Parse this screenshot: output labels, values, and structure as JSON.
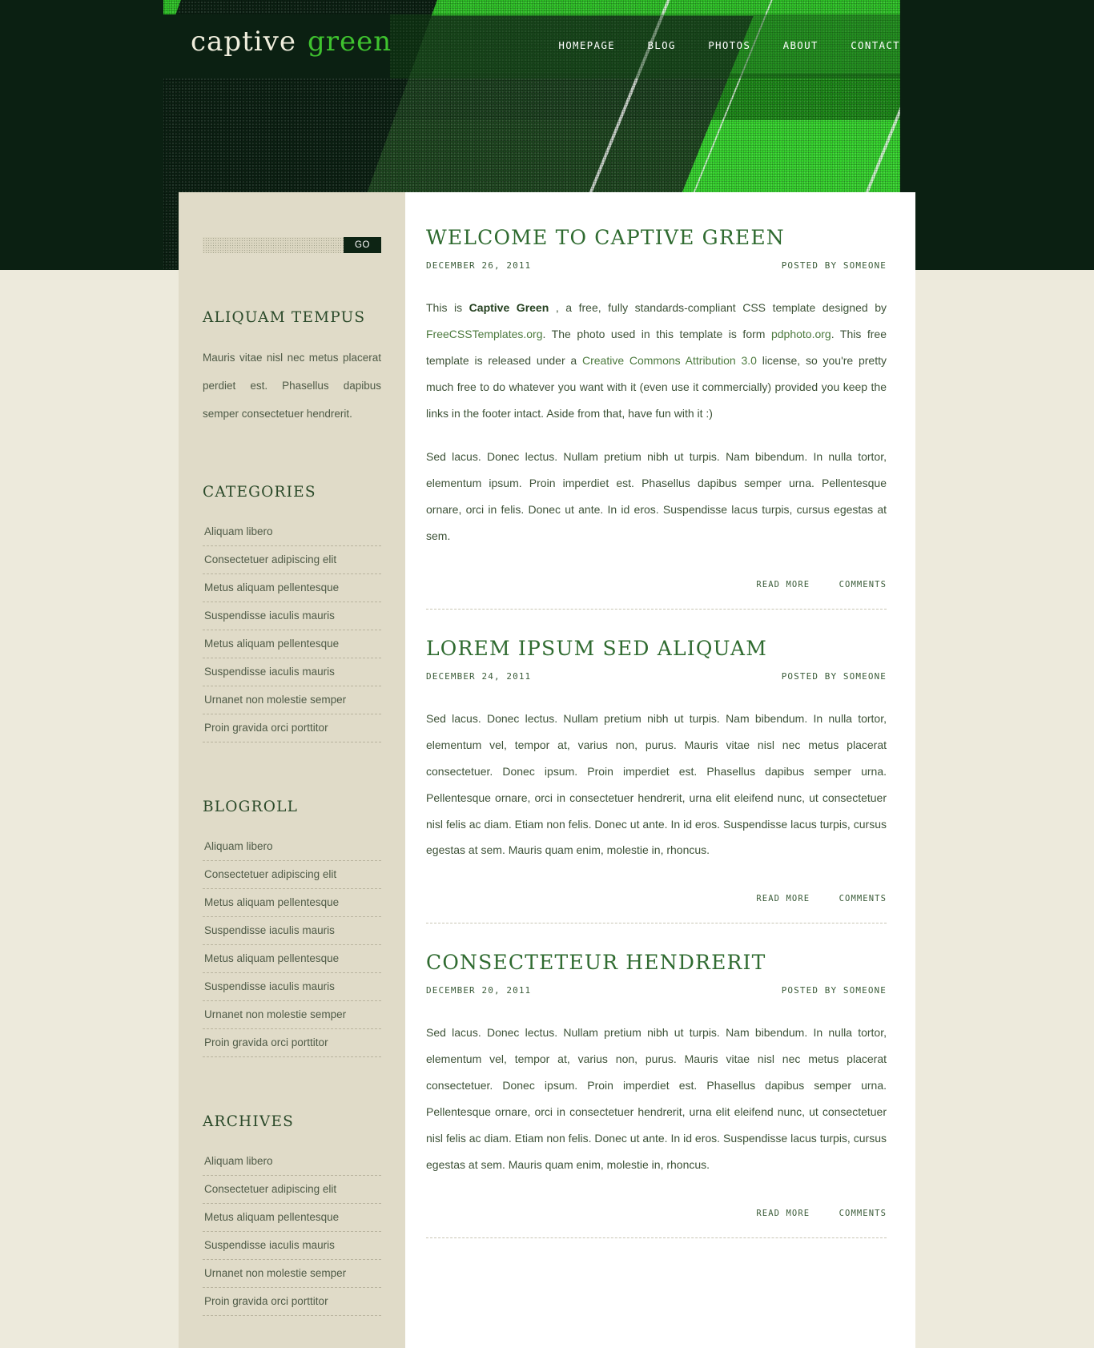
{
  "site": {
    "logo_word1": "captive",
    "logo_word2": "green",
    "accent_green": "#3FC32F",
    "dark_green": "#0B2012",
    "cream": "#EDEADC",
    "sidebar_bg": "#E0DBC8"
  },
  "nav": {
    "items": [
      {
        "label": "Homepage"
      },
      {
        "label": "Blog"
      },
      {
        "label": "Photos"
      },
      {
        "label": "About"
      },
      {
        "label": "Contact"
      }
    ]
  },
  "sidebar": {
    "search": {
      "value": "",
      "placeholder": "",
      "button_label": "GO"
    },
    "blurb": {
      "heading": "Aliquam Tempus",
      "text": "Mauris vitae nisl nec metus placerat perdiet est. Phasellus dapibus semper consectetuer hendrerit."
    },
    "sections": [
      {
        "heading": "Categories",
        "items": [
          "Aliquam libero",
          "Consectetuer adipiscing elit",
          "Metus aliquam pellentesque",
          "Suspendisse iaculis mauris",
          "Metus aliquam pellentesque",
          "Suspendisse iaculis mauris",
          "Urnanet non molestie semper",
          "Proin gravida orci porttitor"
        ]
      },
      {
        "heading": "Blogroll",
        "items": [
          "Aliquam libero",
          "Consectetuer adipiscing elit",
          "Metus aliquam pellentesque",
          "Suspendisse iaculis mauris",
          "Metus aliquam pellentesque",
          "Suspendisse iaculis mauris",
          "Urnanet non molestie semper",
          "Proin gravida orci porttitor"
        ]
      },
      {
        "heading": "Archives",
        "items": [
          "Aliquam libero",
          "Consectetuer adipiscing elit",
          "Metus aliquam pellentesque",
          "Suspendisse iaculis mauris",
          "Urnanet non molestie semper",
          "Proin gravida orci porttitor"
        ]
      }
    ]
  },
  "posts": [
    {
      "title": "Welcome to Captive Green",
      "date": "December 26, 2011",
      "author": "Posted by someone",
      "paragraphs": [
        "This is <b>Captive Green</b> , a free, fully standards-compliant CSS template designed by <a href=\"#\">FreeCSSTemplates.org</a>. The photo used in this template is form <a href=\"#\">pdphoto.org</a>. This free template is released under a <a href=\"#\">Creative Commons Attribution 3.0</a> license, so you're pretty much free to do whatever you want with it (even use it commercially) provided you keep the links in the footer intact. Aside from that, have fun with it :)",
        "Sed lacus. Donec lectus. Nullam pretium nibh ut turpis. Nam bibendum. In nulla tortor, elementum ipsum. Proin imperdiet est. Phasellus dapibus semper urna. Pellentesque ornare, orci in felis. Donec ut ante. In id eros. Suspendisse lacus turpis, cursus egestas at sem."
      ],
      "read_more": "Read more",
      "comments": "Comments"
    },
    {
      "title": "Lorem Ipsum Sed Aliquam",
      "date": "December 24, 2011",
      "author": "Posted by someone",
      "paragraphs": [
        "Sed lacus. Donec lectus. Nullam pretium nibh ut turpis. Nam bibendum. In nulla tortor, elementum vel, tempor at, varius non, purus. Mauris vitae nisl nec metus placerat consectetuer. Donec ipsum. Proin imperdiet est. Phasellus dapibus semper urna. Pellentesque ornare, orci in consectetuer hendrerit, urna elit eleifend nunc, ut consectetuer nisl felis ac diam. Etiam non felis. Donec ut ante. In id eros. Suspendisse lacus turpis, cursus egestas at sem. Mauris quam enim, molestie in, rhoncus."
      ],
      "read_more": "Read more",
      "comments": "Comments"
    },
    {
      "title": "Consecteteur Hendrerit",
      "date": "December 20, 2011",
      "author": "Posted by someone",
      "paragraphs": [
        "Sed lacus. Donec lectus. Nullam pretium nibh ut turpis. Nam bibendum. In nulla tortor, elementum vel, tempor at, varius non, purus. Mauris vitae nisl nec metus placerat consectetuer. Donec ipsum. Proin imperdiet est. Phasellus dapibus semper urna. Pellentesque ornare, orci in consectetuer hendrerit, urna elit eleifend nunc, ut consectetuer nisl felis ac diam. Etiam non felis. Donec ut ante. In id eros. Suspendisse lacus turpis, cursus egestas at sem. Mauris quam enim, molestie in, rhoncus."
      ],
      "read_more": "Read more",
      "comments": "Comments"
    }
  ]
}
